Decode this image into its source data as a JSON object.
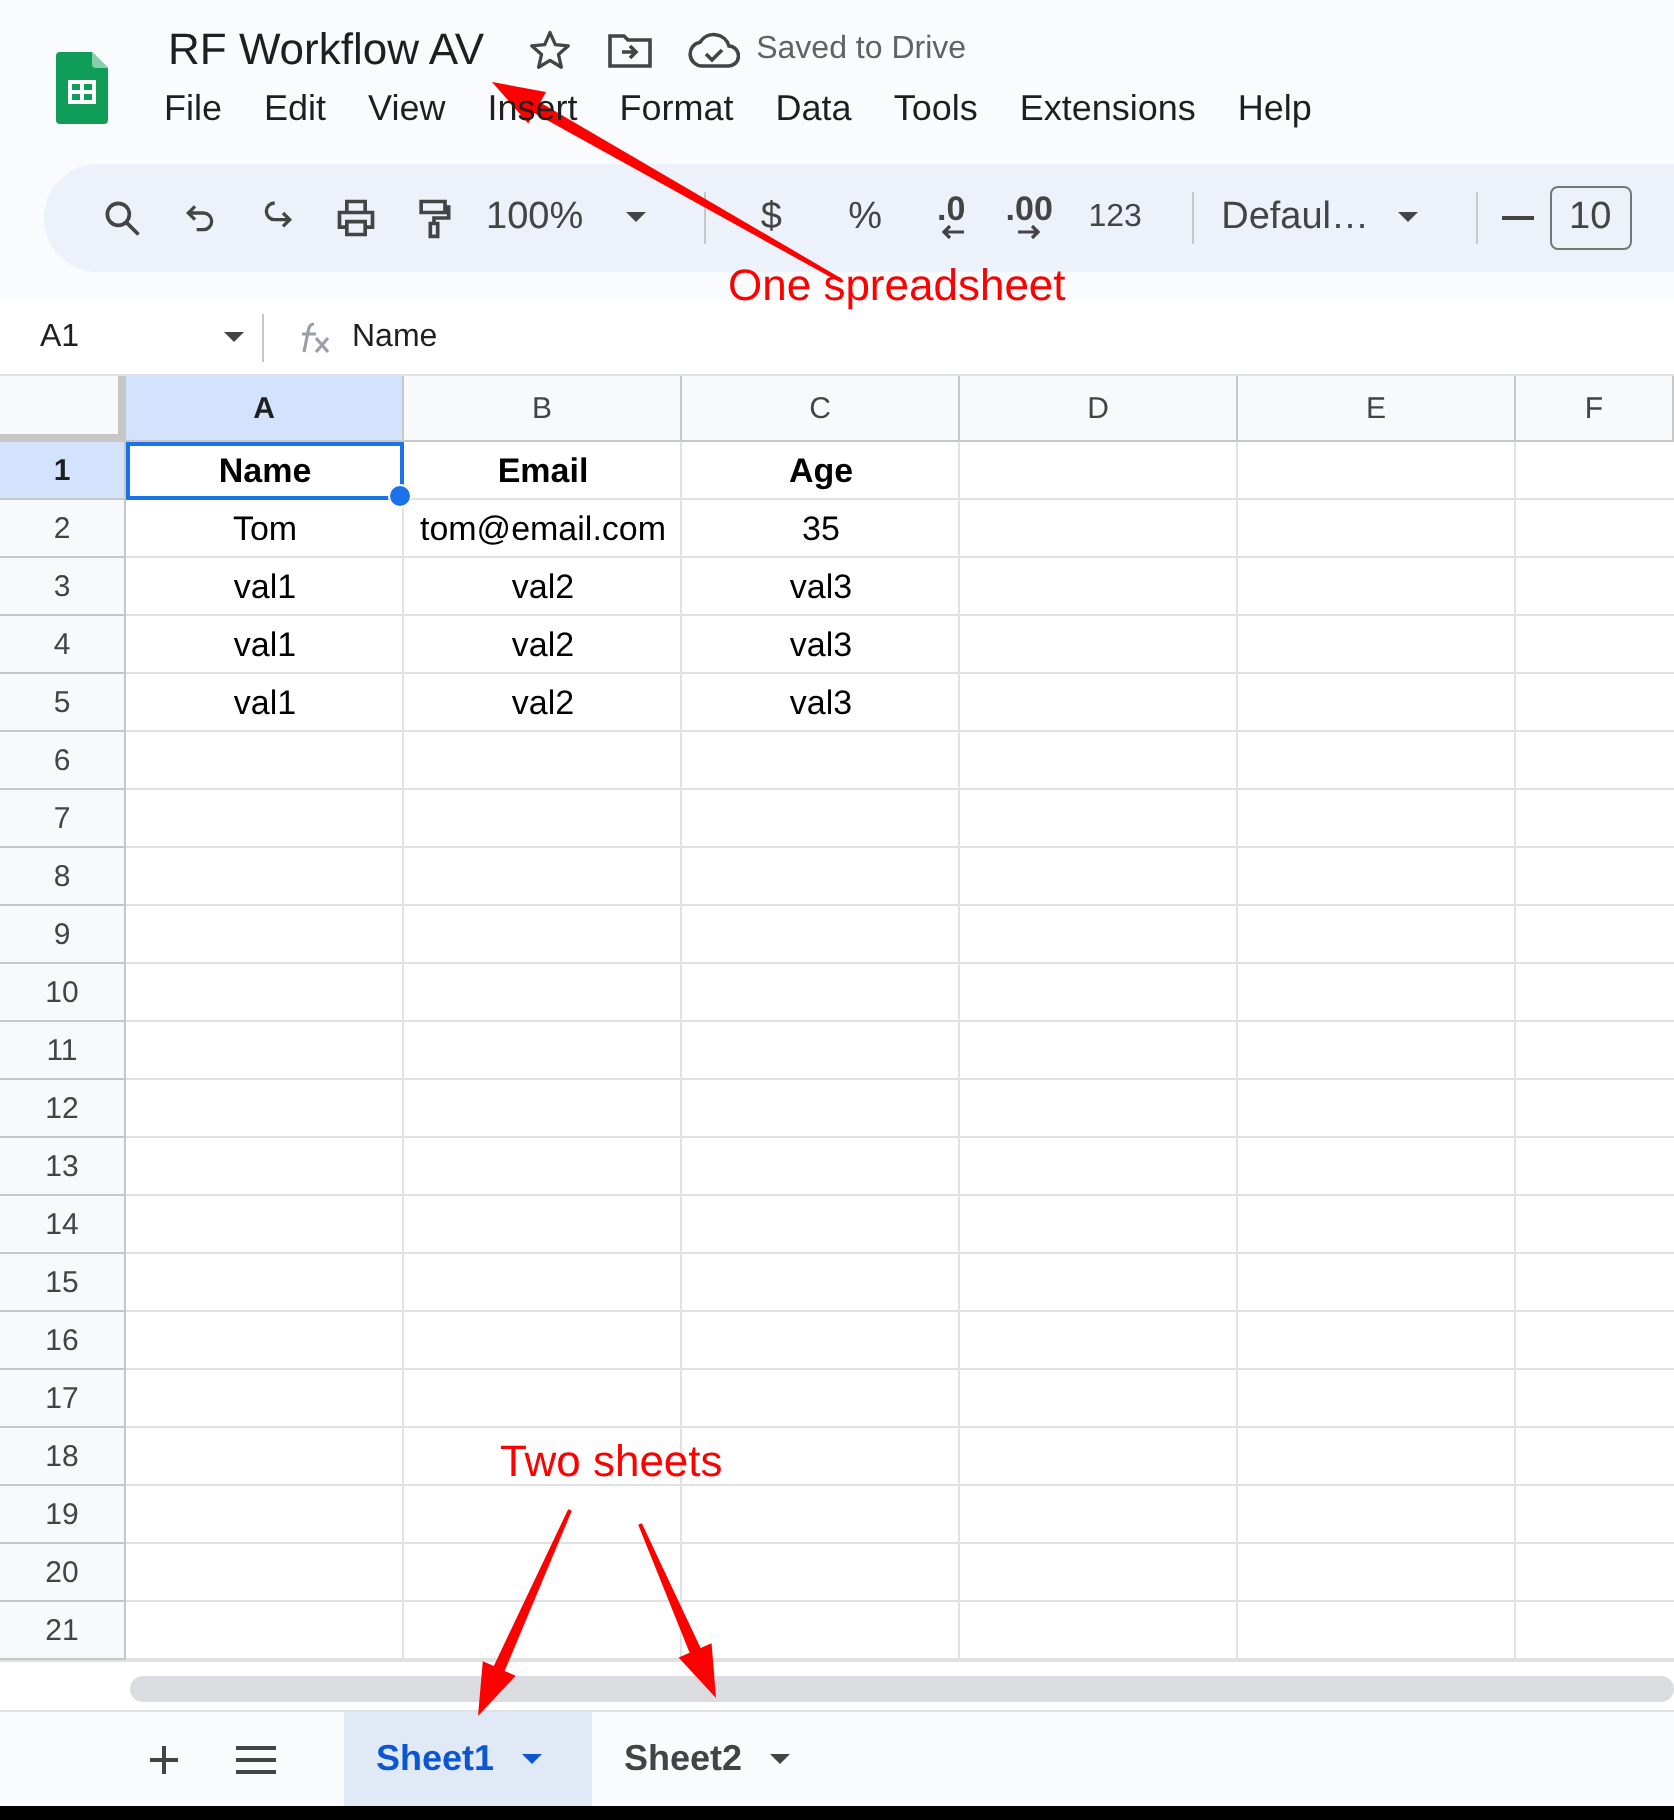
{
  "title": "RF Workflow AV",
  "save_status": "Saved to Drive",
  "menu": [
    "File",
    "Edit",
    "View",
    "Insert",
    "Format",
    "Data",
    "Tools",
    "Extensions",
    "Help"
  ],
  "toolbar": {
    "zoom": "100%",
    "currency": "$",
    "percent": "%",
    "decrease_decimals": ".0",
    "increase_decimals": ".00",
    "number_format": "123",
    "font": "Defaul…",
    "font_size": "10"
  },
  "formula_bar": {
    "cell_ref": "A1",
    "formula": "Name"
  },
  "columns": [
    {
      "label": "A",
      "selected": true
    },
    {
      "label": "B",
      "selected": false
    },
    {
      "label": "C",
      "selected": false
    },
    {
      "label": "D",
      "selected": false
    },
    {
      "label": "E",
      "selected": false
    },
    {
      "label": "F",
      "selected": false
    }
  ],
  "rows": [
    {
      "number": "1",
      "selected": true,
      "kind": "header",
      "cells": [
        "Name",
        "Email",
        "Age"
      ]
    },
    {
      "number": "2",
      "selected": false,
      "kind": "data",
      "cells": [
        "Tom",
        "tom@email.com",
        "35"
      ]
    },
    {
      "number": "3",
      "selected": false,
      "kind": "data",
      "cells": [
        "val1",
        "val2",
        "val3"
      ]
    },
    {
      "number": "4",
      "selected": false,
      "kind": "data",
      "cells": [
        "val1",
        "val2",
        "val3"
      ]
    },
    {
      "number": "5",
      "selected": false,
      "kind": "data",
      "cells": [
        "val1",
        "val2",
        "val3"
      ]
    },
    {
      "number": "6",
      "selected": false,
      "kind": "data"
    },
    {
      "number": "7",
      "selected": false,
      "kind": "data"
    },
    {
      "number": "8",
      "selected": false,
      "kind": "data"
    },
    {
      "number": "9",
      "selected": false,
      "kind": "data"
    },
    {
      "number": "10",
      "selected": false,
      "kind": "data"
    },
    {
      "number": "11",
      "selected": false,
      "kind": "data"
    },
    {
      "number": "12",
      "selected": false,
      "kind": "data"
    },
    {
      "number": "13",
      "selected": false,
      "kind": "data"
    },
    {
      "number": "14",
      "selected": false,
      "kind": "data"
    },
    {
      "number": "15",
      "selected": false,
      "kind": "data"
    },
    {
      "number": "16",
      "selected": false,
      "kind": "data"
    },
    {
      "number": "17",
      "selected": false,
      "kind": "data"
    },
    {
      "number": "18",
      "selected": false,
      "kind": "data"
    },
    {
      "number": "19",
      "selected": false,
      "kind": "data"
    },
    {
      "number": "20",
      "selected": false,
      "kind": "data"
    },
    {
      "number": "21",
      "selected": false,
      "kind": "data"
    }
  ],
  "sheets": [
    {
      "name": "Sheet1",
      "selected": true
    },
    {
      "name": "Sheet2",
      "selected": false
    }
  ],
  "annotations": [
    {
      "text": "One spreadsheet"
    },
    {
      "text": "Two sheets"
    }
  ]
}
